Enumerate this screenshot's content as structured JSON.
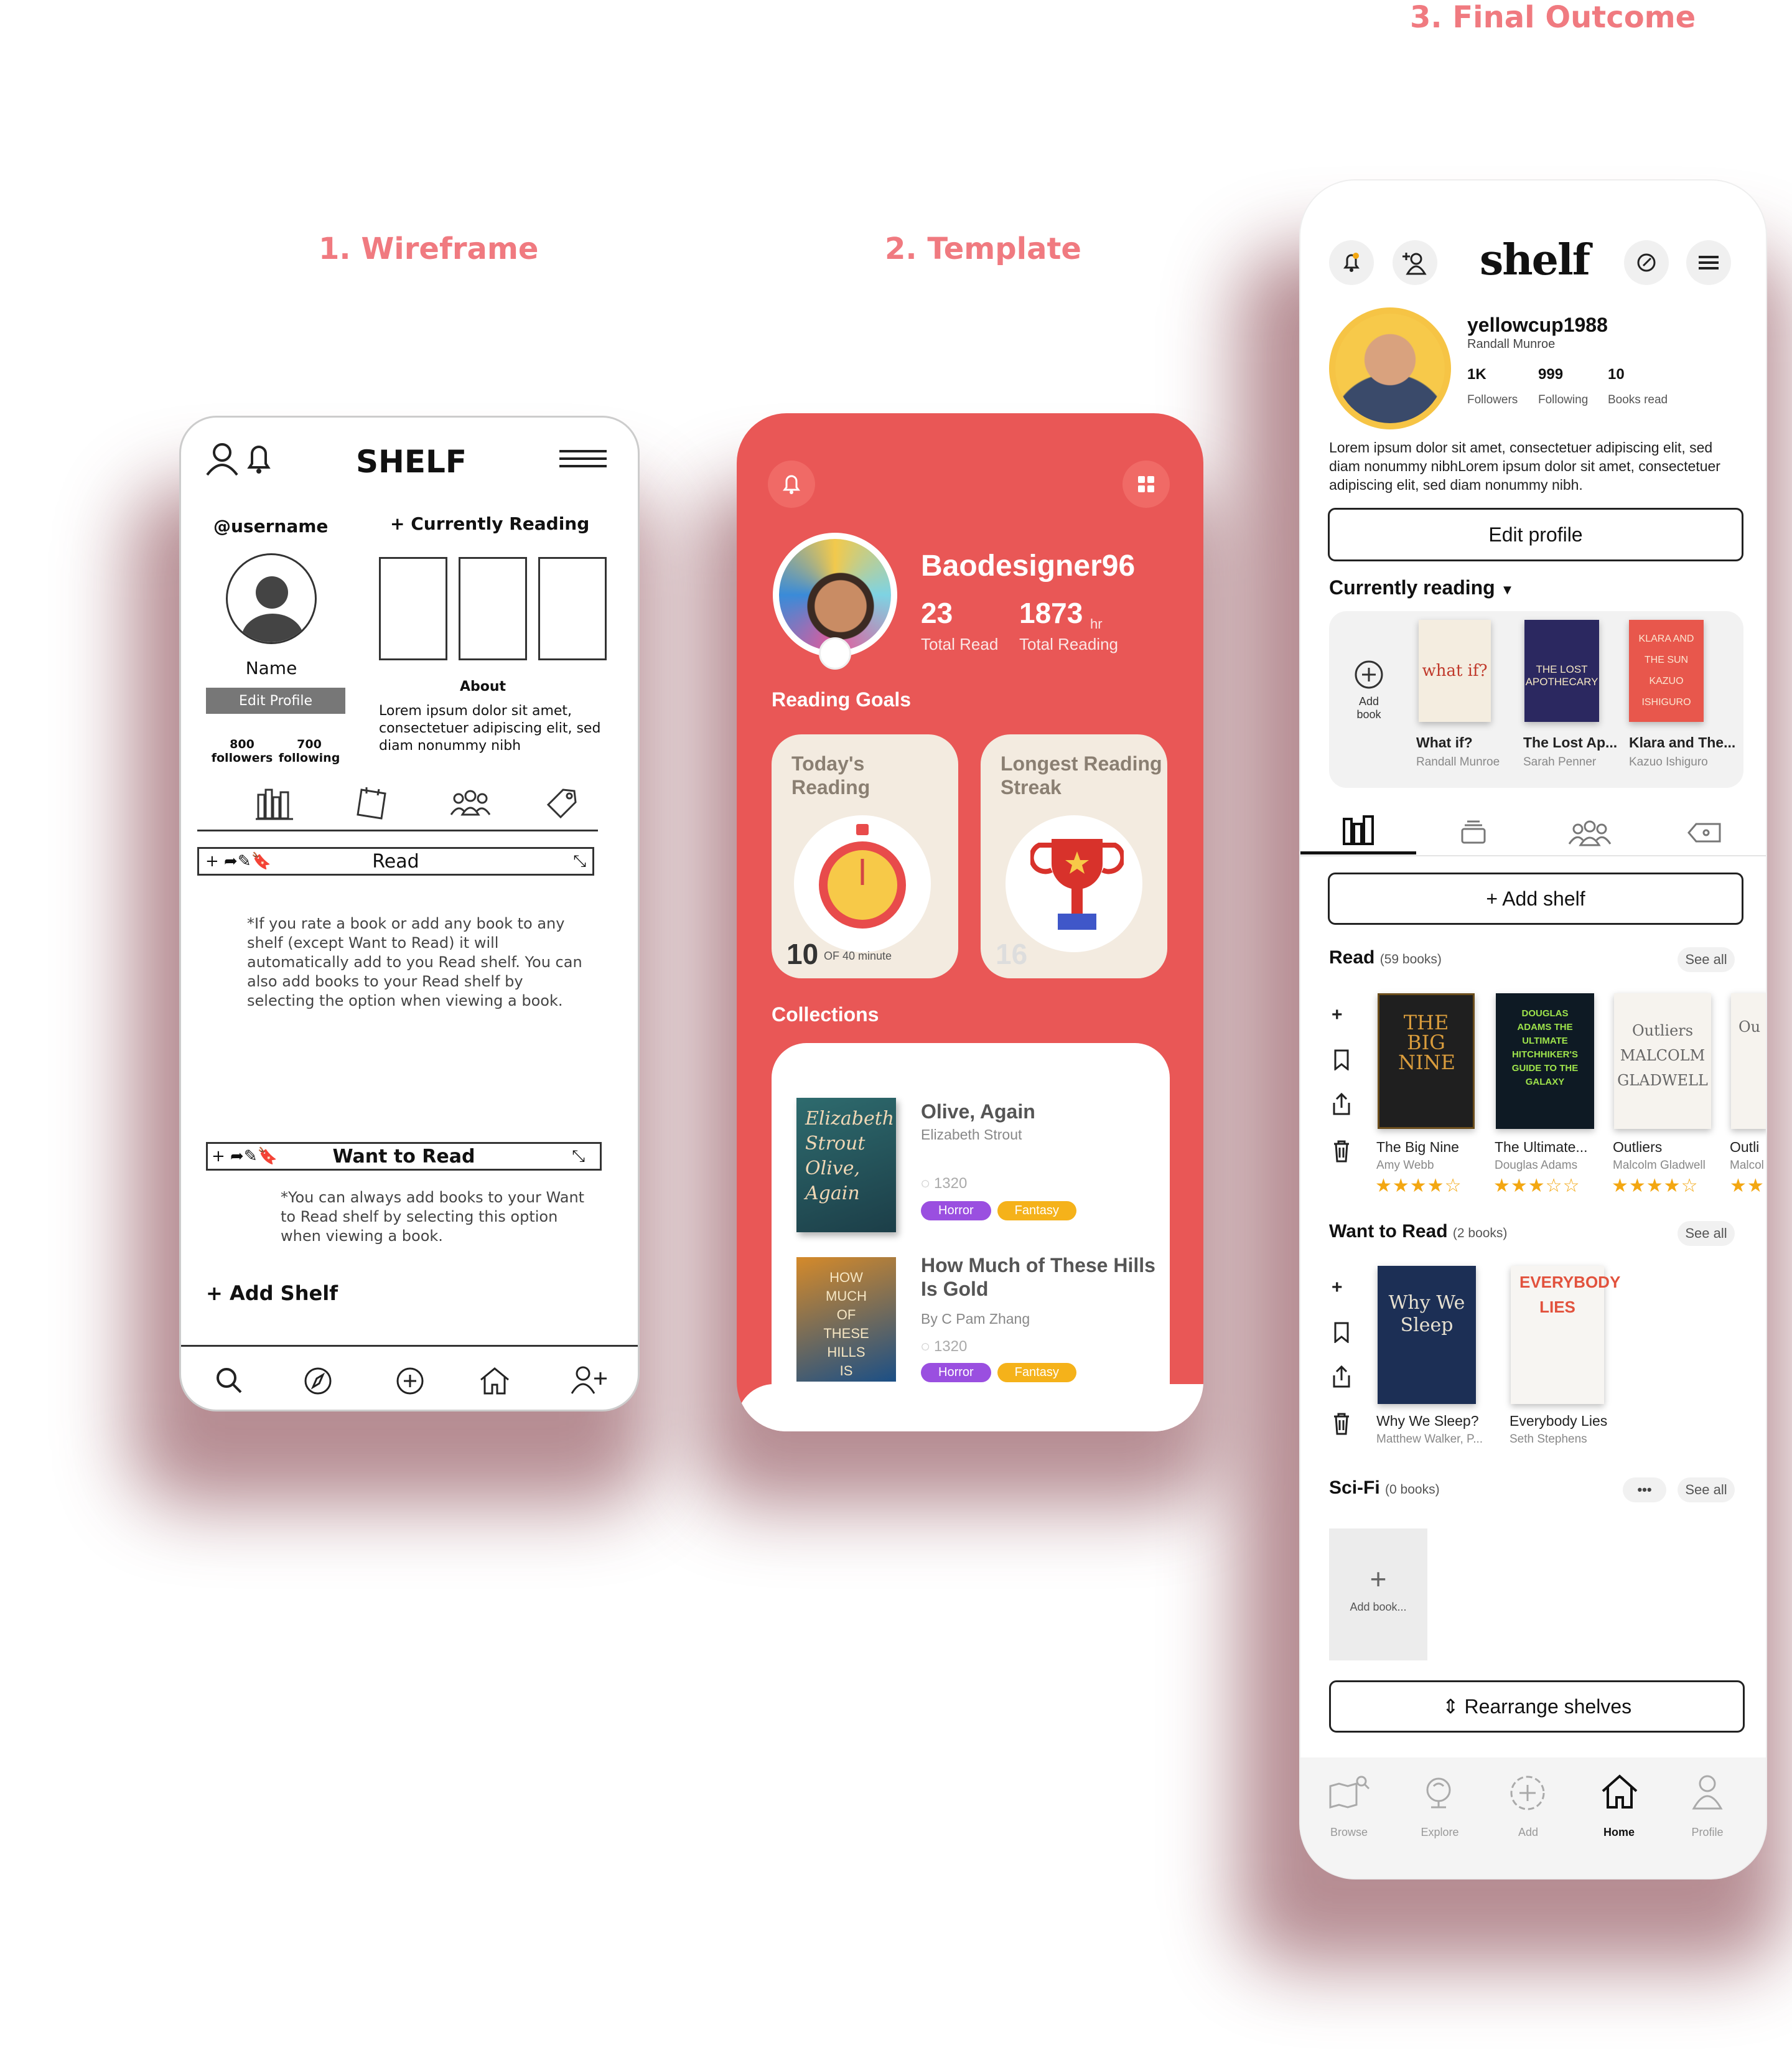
{
  "labels": {
    "wireframe": "1. Wireframe",
    "template": "2. Template",
    "final": "3. Final Outcome"
  },
  "wireframe": {
    "title": "SHELF",
    "username": "@username",
    "currently_reading": "+ Currently Reading",
    "name": "Name",
    "edit_profile": "Edit Profile",
    "about_title": "About",
    "about_text": "Lorem ipsum dolor sit amet, consectetuer adipiscing elit, sed diam nonummy nibh",
    "followers_count": "800",
    "followers_label": "followers",
    "following_count": "700",
    "following_label": "following",
    "read_shelf": "Read",
    "read_note": "*If you rate a book or add any book to any shelf (except Want to Read) it will automatically add to you Read shelf. You can also add books to your Read shelf by selecting the option when viewing a book.",
    "want_shelf": "Want to Read",
    "want_note": "*You can always add books to your Want to Read shelf by selecting this option when viewing a book.",
    "add_shelf": "+ Add Shelf",
    "bar_tools": "+ ➦✎🔖"
  },
  "template": {
    "username": "Baodesigner96",
    "total_read_value": "23",
    "total_read_label": "Total Read",
    "total_reading_value": "1873",
    "total_reading_unit": "hr",
    "total_reading_label": "Total Reading",
    "reading_goals": "Reading Goals",
    "today_title": "Today's Reading",
    "today_value": "10",
    "today_of": "OF 40 minute",
    "streak_title": "Longest Reading Streak",
    "streak_value": "16",
    "collections": "Collections",
    "books": [
      {
        "title": "Olive, Again",
        "author": "Elizabeth Strout",
        "count": "1320",
        "tags": [
          "Horror",
          "Fantasy"
        ],
        "cover_text": "Elizabeth Strout Olive, Again"
      },
      {
        "title": "How Much of These Hills Is Gold",
        "author": "By C Pam Zhang",
        "count": "1320",
        "tags": [
          "Horror",
          "Fantasy"
        ],
        "cover_text": "HOW MUCH OF THESE HILLS IS GOLD"
      }
    ]
  },
  "final": {
    "logo": "shelf",
    "username": "yellowcup1988",
    "realname": "Randall Munroe",
    "stats": [
      {
        "value": "1K",
        "label": "Followers"
      },
      {
        "value": "999",
        "label": "Following"
      },
      {
        "value": "10",
        "label": "Books read"
      }
    ],
    "bio": "Lorem ipsum dolor sit amet, consectetuer adipiscing elit, sed diam nonummy nibhLorem ipsum dolor sit amet, consectetuer adipiscing elit, sed diam nonummy nibh.",
    "edit_profile": "Edit profile",
    "currently_reading": "Currently reading",
    "add_book": "Add book",
    "current_books": [
      {
        "title": "What if?",
        "author": "Randall Munroe",
        "cover": "what if?"
      },
      {
        "title": "The Lost Ap...",
        "author": "Sarah Penner",
        "cover": "THE LOST APOTHECARY"
      },
      {
        "title": "Klara and The...",
        "author": "Kazuo Ishiguro",
        "cover": "KLARA AND THE SUN KAZUO ISHIGURO"
      }
    ],
    "add_shelf": "+ Add shelf",
    "see_all": "See all",
    "read_shelf": {
      "name": "Read",
      "count": "(59 books)"
    },
    "read_books": [
      {
        "title": "The Big Nine",
        "author": "Amy Webb",
        "stars": "★★★★☆",
        "cover": "THE BIG NINE"
      },
      {
        "title": "The Ultimate...",
        "author": "Douglas Adams",
        "stars": "★★★☆☆",
        "cover": "DOUGLAS ADAMS THE ULTIMATE HITCHHIKER'S GUIDE TO THE GALAXY"
      },
      {
        "title": "Outliers",
        "author": "Malcolm Gladwell",
        "stars": "★★★★☆",
        "cover": "Outliers MALCOLM GLADWELL"
      },
      {
        "title": "Outli",
        "author": "Malcol",
        "stars": "★★",
        "cover": "Ou"
      }
    ],
    "want_shelf": {
      "name": "Want to Read",
      "count": "(2 books)"
    },
    "want_books": [
      {
        "title": "Why We Sleep?",
        "author": "Matthew Walker, P...",
        "cover": "Why We Sleep"
      },
      {
        "title": "Everybody Lies",
        "author": "Seth Stephens",
        "cover": "EVERYBODY LIES"
      }
    ],
    "scifi_shelf": {
      "name": "Sci-Fi",
      "count": "(0 books)"
    },
    "add_book_slot": "Add book...",
    "more": "•••",
    "rearrange": "⇕ Rearrange shelves",
    "nav": [
      "Browse",
      "Explore",
      "Add",
      "Home",
      "Profile"
    ],
    "nav_active": "Home"
  },
  "colors": {
    "accent_wireframe": "#333333",
    "template_red": "#e95756",
    "label_pink": "#f07a80",
    "star": "#f3a712",
    "horror": "#9a4fe0",
    "fantasy": "#f5b21a"
  }
}
